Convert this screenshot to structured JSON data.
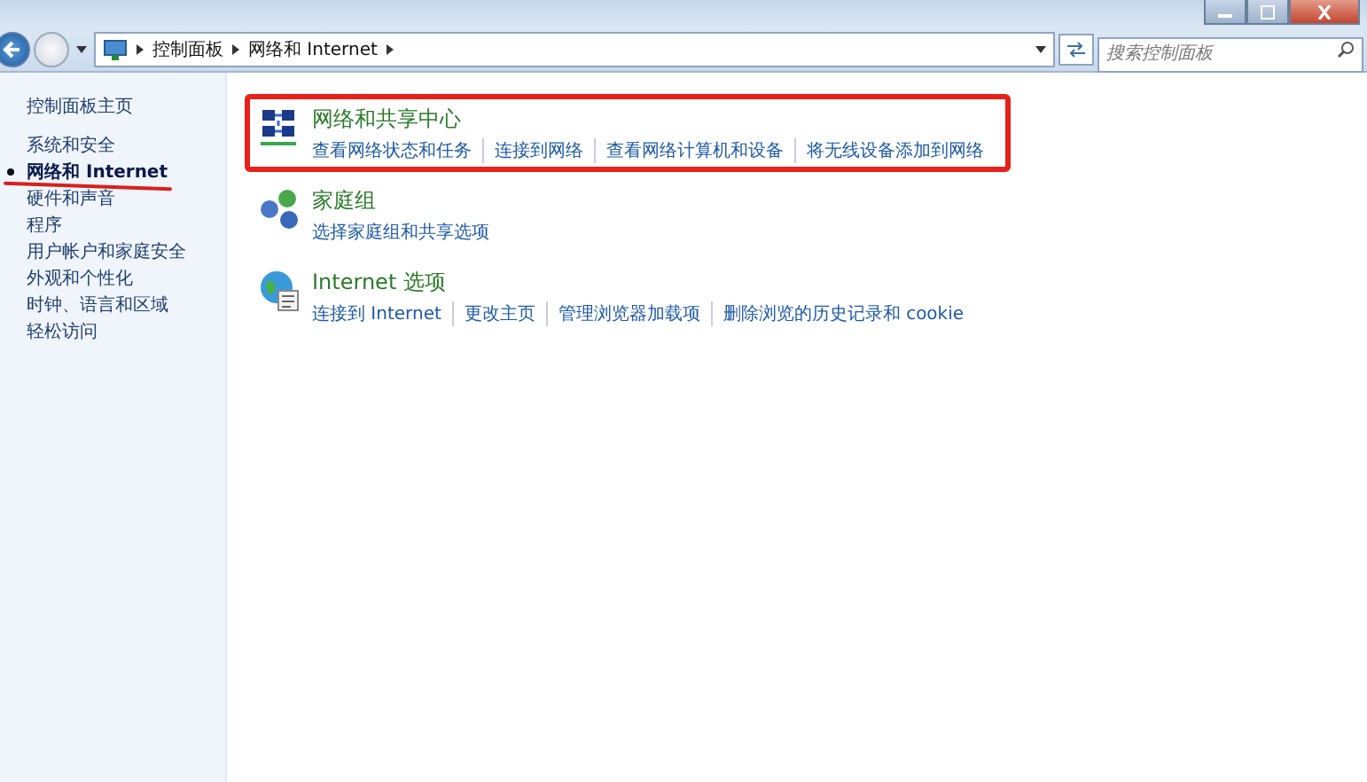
{
  "address_bar": {
    "crumbs": [
      "控制面板",
      "网络和 Internet"
    ]
  },
  "search": {
    "placeholder": "搜索控制面板"
  },
  "sidebar": {
    "home": "控制面板主页",
    "items": [
      {
        "label": "系统和安全",
        "selected": false,
        "underlined": false
      },
      {
        "label": "网络和 Internet",
        "selected": true,
        "underlined": true
      },
      {
        "label": "硬件和声音",
        "selected": false,
        "underlined": false
      },
      {
        "label": "程序",
        "selected": false,
        "underlined": false
      },
      {
        "label": "用户帐户和家庭安全",
        "selected": false,
        "underlined": false
      },
      {
        "label": "外观和个性化",
        "selected": false,
        "underlined": false
      },
      {
        "label": "时钟、语言和区域",
        "selected": false,
        "underlined": false
      },
      {
        "label": "轻松访问",
        "selected": false,
        "underlined": false
      }
    ]
  },
  "categories": [
    {
      "kind": "network",
      "title": "网络和共享中心",
      "highlighted": true,
      "links": [
        "查看网络状态和任务",
        "连接到网络",
        "查看网络计算机和设备",
        "将无线设备添加到网络"
      ]
    },
    {
      "kind": "homegroup",
      "title": "家庭组",
      "highlighted": false,
      "links": [
        "选择家庭组和共享选项"
      ]
    },
    {
      "kind": "internet",
      "title": "Internet 选项",
      "highlighted": false,
      "links": [
        "连接到 Internet",
        "更改主页",
        "管理浏览器加载项",
        "删除浏览的历史记录和 cookie"
      ]
    }
  ]
}
